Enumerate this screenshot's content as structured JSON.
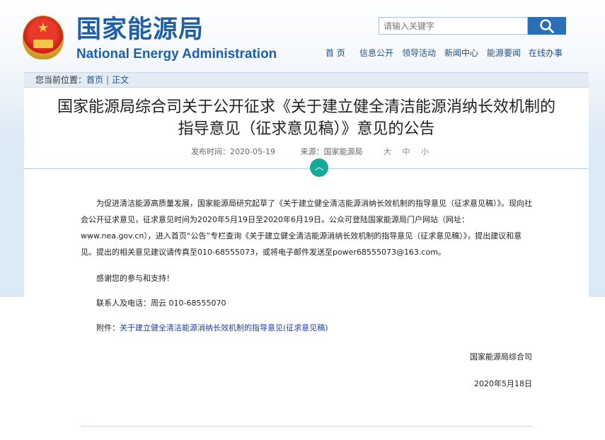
{
  "site": {
    "name_cn": "国家能源局",
    "name_en": "National Energy Administration"
  },
  "search": {
    "placeholder": "请输入关键字",
    "button_icon": "search-icon"
  },
  "nav": [
    "首 页",
    "信息公开",
    "领导活动",
    "新闻中心",
    "能源要闻",
    "在线办事"
  ],
  "breadcrumb": {
    "prefix": "您当前位置：",
    "items": [
      "首页",
      "正文"
    ],
    "separator": "|"
  },
  "article": {
    "title_line1": "国家能源局综合司关于公开征求《关于建立健全清洁能源消纳长效机制的",
    "title_line2": "指导意见（征求意见稿）》意见的公告",
    "publish_label": "发布时间：",
    "publish_date": "2020-05-19",
    "source_label": "来源：",
    "source": "国家能源局",
    "font_sizes": "大 中 小",
    "paragraph1": "为促进清洁能源高质量发展，国家能源局研究起草了《关于建立健全清洁能源消纳长效机制的指导意见（征求意见稿）》。现向社会公开征求意见，征求意见时间为2020年5月19日至2020年6月19日。公众可登陆国家能源局门户网站（网址：www.nea.gov.cn），进入首页“公告”专栏查询《关于建立健全清洁能源消纳长效机制的指导意见（征求意见稿）》，提出建议和意见。提出的相关意见建议请传真至010-68555073，或将电子邮件发送至power68555073@163.com。",
    "thanks": "感谢您的参与和支持！",
    "contact": "联系人及电话：周云 010-68555070",
    "attachment_label": "附件：",
    "attachment_link": "关于建立健全清洁能源消纳长效机制的指导意见(征求意见稿)",
    "signature": "国家能源局综合司",
    "date": "2020年5月18日"
  },
  "colors": {
    "brand_blue": "#1f5fa8",
    "toggle_teal": "#16a89a"
  }
}
